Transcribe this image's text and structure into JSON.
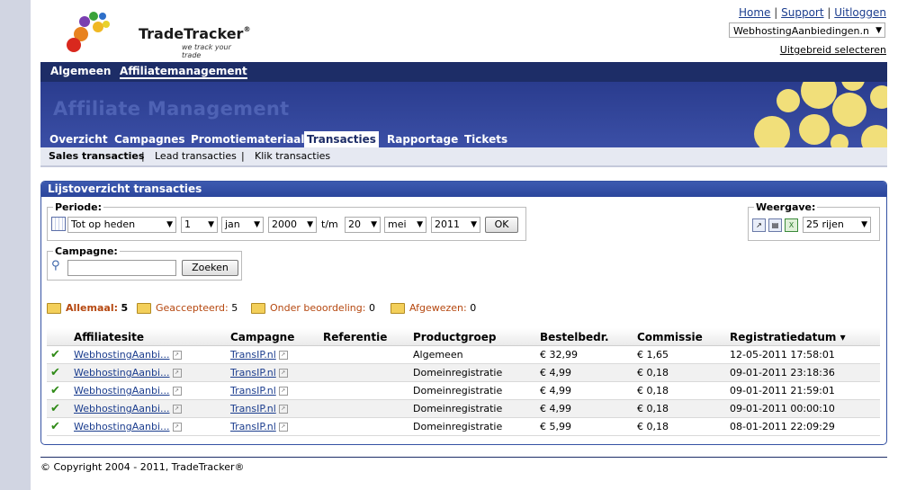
{
  "brand": {
    "name": "TradeTracker",
    "reg": "®",
    "tagline": "we track your trade"
  },
  "toplinks": {
    "home": "Home",
    "support": "Support",
    "logout": "Uitloggen",
    "sep": "|"
  },
  "site_select": {
    "value": "WebhostingAanbiedingen.n"
  },
  "advanced_link": "Uitgebreid selecteren",
  "main_nav": [
    "Algemeen",
    "Affiliatemanagement"
  ],
  "banner_title": "Affiliate Management",
  "sub_nav": [
    "Overzicht",
    "Campagnes",
    "Promotiemateriaal",
    "Transacties",
    "Rapportage",
    "Tickets"
  ],
  "subsub_nav": [
    "Sales transacties",
    "Lead transacties",
    "Klik transacties"
  ],
  "panel_title": "Lijstoverzicht transacties",
  "period": {
    "legend": "Periode:",
    "range": "Tot op heden",
    "from_day": "1",
    "from_month": "jan",
    "from_year": "2000",
    "to_label": "t/m",
    "to_day": "20",
    "to_month": "mei",
    "to_year": "2011",
    "ok": "OK"
  },
  "view": {
    "legend": "Weergave:",
    "rows": "25 rijen"
  },
  "campaign": {
    "legend": "Campagne:",
    "value": "",
    "search": "Zoeken"
  },
  "filters": [
    {
      "label": "Allemaal:",
      "count": "5"
    },
    {
      "label": "Geaccepteerd:",
      "count": "5"
    },
    {
      "label": "Onder beoordeling:",
      "count": "0"
    },
    {
      "label": "Afgewezen:",
      "count": "0"
    }
  ],
  "columns": [
    "Affiliatesite",
    "Campagne",
    "Referentie",
    "Productgroep",
    "Bestelbedr.",
    "Commissie",
    "Registratiedatum"
  ],
  "sort_indicator": "▾",
  "rows": [
    {
      "site": "WebhostingAanbi...",
      "campaign": "TransIP.nl",
      "ref": "",
      "group": "Algemeen",
      "amount": "€ 32,99",
      "commission": "€ 1,65",
      "date": "12-05-2011 17:58:01"
    },
    {
      "site": "WebhostingAanbi...",
      "campaign": "TransIP.nl",
      "ref": "",
      "group": "Domeinregistratie",
      "amount": "€ 4,99",
      "commission": "€ 0,18",
      "date": "09-01-2011 23:18:36"
    },
    {
      "site": "WebhostingAanbi...",
      "campaign": "TransIP.nl",
      "ref": "",
      "group": "Domeinregistratie",
      "amount": "€ 4,99",
      "commission": "€ 0,18",
      "date": "09-01-2011 21:59:01"
    },
    {
      "site": "WebhostingAanbi...",
      "campaign": "TransIP.nl",
      "ref": "",
      "group": "Domeinregistratie",
      "amount": "€ 4,99",
      "commission": "€ 0,18",
      "date": "09-01-2011 00:00:10"
    },
    {
      "site": "WebhostingAanbi...",
      "campaign": "TransIP.nl",
      "ref": "",
      "group": "Domeinregistratie",
      "amount": "€ 5,99",
      "commission": "€ 0,18",
      "date": "08-01-2011 22:09:29"
    }
  ],
  "copyright": "© Copyright 2004 - 2011, TradeTracker®",
  "colors": {
    "nav": "#1d2d67",
    "banner": "#2a3c8e",
    "accent": "#f1df7a",
    "link": "#1b3d8e",
    "check": "#2f8a17"
  }
}
